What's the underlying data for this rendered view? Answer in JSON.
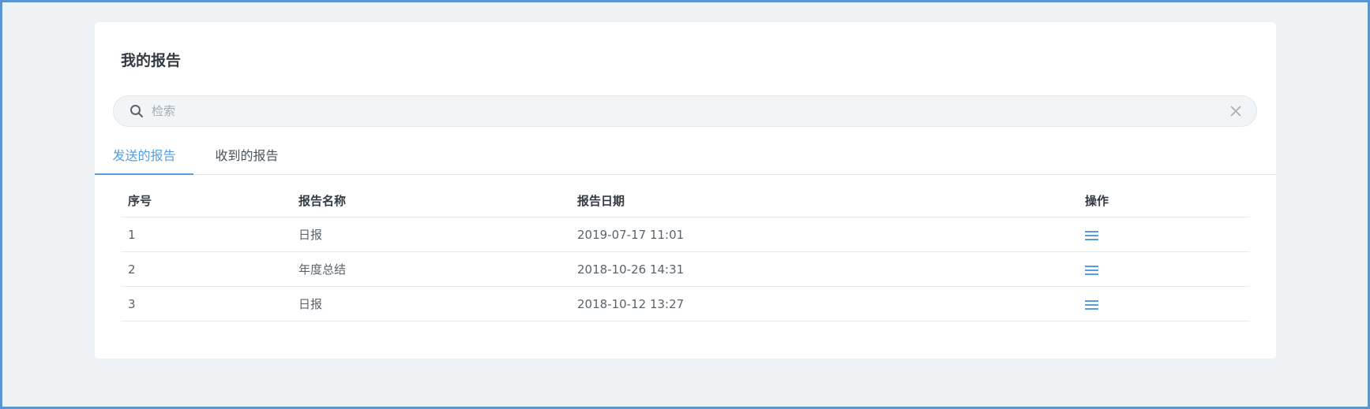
{
  "page": {
    "title": "我的报告"
  },
  "search": {
    "placeholder": "检索",
    "value": ""
  },
  "tabs": [
    {
      "label": "发送的报告",
      "active": true
    },
    {
      "label": "收到的报告",
      "active": false
    }
  ],
  "table": {
    "headers": [
      "序号",
      "报告名称",
      "报告日期",
      "操作"
    ],
    "rows": [
      {
        "index": "1",
        "name": "日报",
        "date": "2019-07-17 11:01",
        "action_icon": "menu-icon"
      },
      {
        "index": "2",
        "name": "年度总结",
        "date": "2018-10-26 14:31",
        "action_icon": "menu-icon"
      },
      {
        "index": "3",
        "name": "日报",
        "date": "2018-10-12 13:27",
        "action_icon": "menu-icon"
      }
    ]
  },
  "colors": {
    "accent": "#5a9ddc",
    "frame": "#5b95cf",
    "background": "#eff2f4"
  }
}
